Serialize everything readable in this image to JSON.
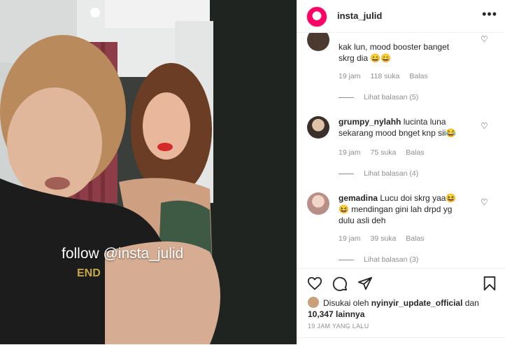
{
  "post": {
    "username": "insta_julid",
    "watermark": "follow @insta_julid",
    "more_label": "•••"
  },
  "comments": [
    {
      "username": "",
      "text": "kak lun, mood booster banget skrg dia 😄😄",
      "time": "19 jam",
      "likes": "118 suka",
      "reply": "Balas",
      "view_replies": "Lihat balasan (5)"
    },
    {
      "username": "grumpy_nylahh",
      "text": "lucinta luna sekarang mood bnget knp sii😂",
      "time": "19 jam",
      "likes": "75 suka",
      "reply": "Balas",
      "view_replies": "Lihat balasan (4)"
    },
    {
      "username": "gemadina",
      "text": "Lucu doi skrg yaa😆 😆 mendingan gini lah drpd yg dulu asli deh",
      "time": "19 jam",
      "likes": "39 suka",
      "reply": "Balas",
      "view_replies": "Lihat balasan (3)"
    }
  ],
  "likes": {
    "prefix": "Disukai oleh",
    "liker": "nyinyir_update_official",
    "connector": "dan",
    "others": "10,347 lainnya"
  },
  "time_ago": "19 JAM YANG LALU",
  "icons": [
    "heart-icon",
    "comment-icon",
    "share-icon",
    "bookmark-icon",
    "more-icon"
  ]
}
